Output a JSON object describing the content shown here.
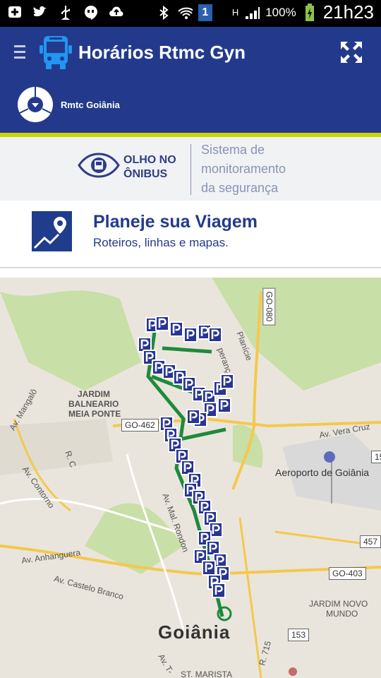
{
  "status": {
    "battery": "100%",
    "time": "21h23",
    "notification_badge": "1",
    "network": "H",
    "icons": [
      "add-icon",
      "twitter-icon",
      "usb-icon",
      "hangouts-icon",
      "upload-icon",
      "bluetooth-icon",
      "wifi-icon",
      "signal-icon",
      "battery-icon"
    ]
  },
  "appbar": {
    "title": "Horários Rtmc Gyn",
    "icons": [
      "menu-icon",
      "bus-icon",
      "expand-icon"
    ]
  },
  "brand": {
    "name": "Rmtc Goiânia"
  },
  "banner": {
    "brand_line1": "OLHO NO",
    "brand_line2": "ÔNIBUS",
    "tagline": [
      "Sistema de",
      "monitoramento",
      "da segurança"
    ]
  },
  "plan": {
    "title": "Planeje sua Viagem",
    "subtitle": "Roteiros, linhas e mapas."
  },
  "map": {
    "labels": {
      "jardim1": "JARDIM",
      "jardim2": "BALNEARIO",
      "jardim3": "MEIA PONTE",
      "mangalo": "Av. Mangalô",
      "contorno": "Av. Contorno",
      "rc": "R. C",
      "anhanguera": "Av. Anhanguera",
      "castelo": "Av. Castelo Branco",
      "rondon": "Av. Mal. Rondon",
      "veracruz": "Av. Vera Cruz",
      "aeroporto": "Aeroporto de Goiânia",
      "novo1": "JARDIM NOVO",
      "novo2": "MUNDO",
      "marista": "ST. MARISTA",
      "planicie": "Planície",
      "peranca": "peranç",
      "r715": "R. 715",
      "avt": "Av. T-",
      "goiania": "Goiânia"
    },
    "shields": [
      "GO-462",
      "GO-080",
      "457",
      "GO-403",
      "153",
      "15"
    ]
  }
}
